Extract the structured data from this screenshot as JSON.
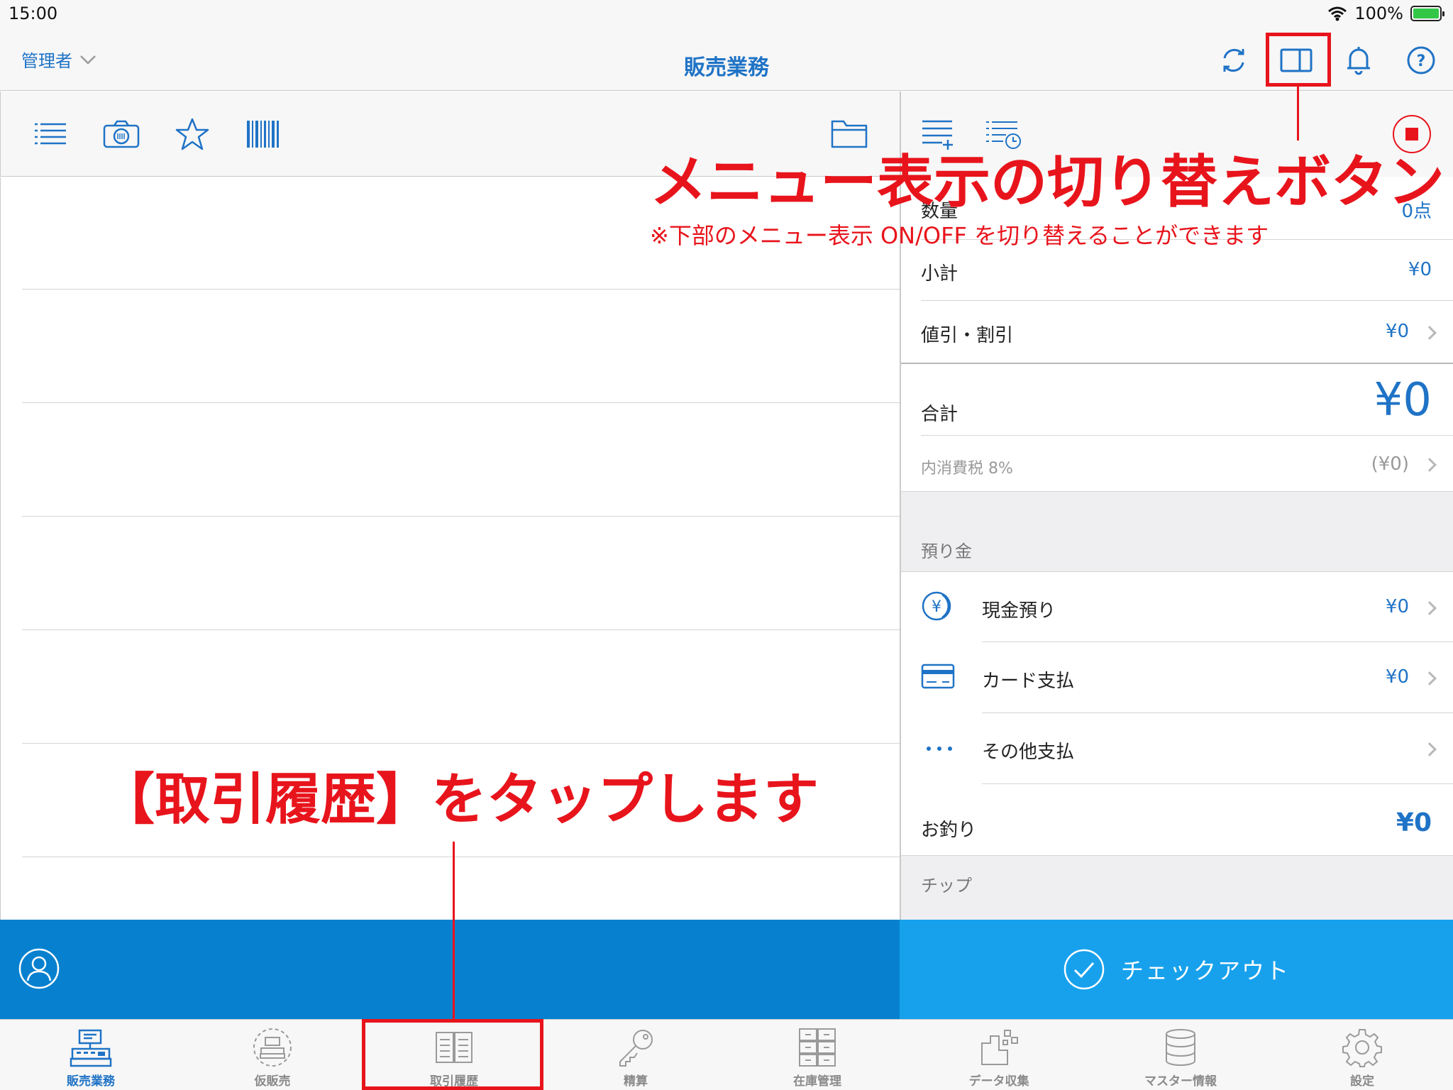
{
  "status_bar": {
    "time": "15:00",
    "battery_text": "100%"
  },
  "nav": {
    "user": "管理者",
    "title": "販売業務"
  },
  "summary": {
    "quantity_label": "数量",
    "quantity_value": "0点",
    "subtotal_label": "小計",
    "subtotal_value": "¥0",
    "discount_label": "値引・割引",
    "discount_value": "¥0",
    "total_label": "合計",
    "total_value": "¥0",
    "tax_label": "内消費税 8%",
    "tax_value": "(¥0)"
  },
  "deposit": {
    "section_label": "預り金",
    "cash_label": "現金預り",
    "cash_value": "¥0",
    "card_label": "カード支払",
    "card_value": "¥0",
    "other_label": "その他支払",
    "change_label": "お釣り",
    "change_value": "¥0"
  },
  "tip": {
    "section_label": "チップ"
  },
  "checkout": {
    "label": "チェックアウト"
  },
  "tabs": [
    {
      "label": "販売業務",
      "icon": "register-icon"
    },
    {
      "label": "仮販売",
      "icon": "temp-sale-icon"
    },
    {
      "label": "取引履歴",
      "icon": "history-icon"
    },
    {
      "label": "精算",
      "icon": "key-icon"
    },
    {
      "label": "在庫管理",
      "icon": "inventory-icon"
    },
    {
      "label": "データ収集",
      "icon": "data-collection-icon"
    },
    {
      "label": "マスター情報",
      "icon": "database-icon"
    },
    {
      "label": "設定",
      "icon": "gear-icon"
    }
  ],
  "annotations": {
    "menu_toggle_title": "メニュー表示の切り替えボタン",
    "menu_toggle_note": "※下部のメニュー表示 ON/OFF を切り替えることができます",
    "history_instruction": "【取引履歴】をタップします"
  },
  "colors": {
    "accent": "#1f73c6",
    "action_left": "#0781cf",
    "action_right": "#17a1ec",
    "annotation": "#e8141c"
  }
}
